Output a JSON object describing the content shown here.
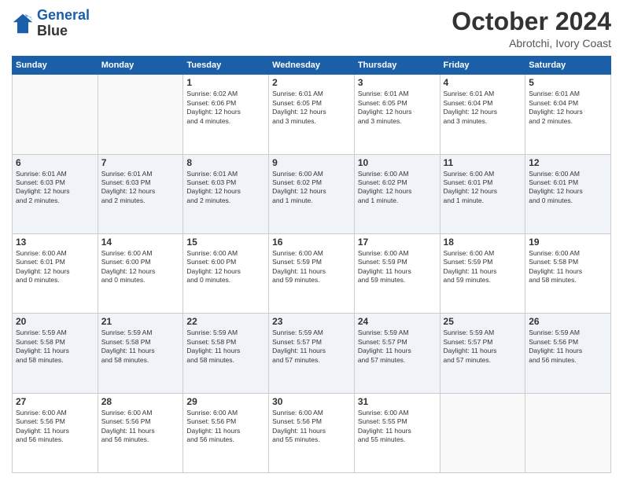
{
  "logo": {
    "line1": "General",
    "line2": "Blue"
  },
  "title": "October 2024",
  "location": "Abrotchi, Ivory Coast",
  "days_header": [
    "Sunday",
    "Monday",
    "Tuesday",
    "Wednesday",
    "Thursday",
    "Friday",
    "Saturday"
  ],
  "weeks": [
    {
      "shaded": false,
      "days": [
        {
          "num": "",
          "text": ""
        },
        {
          "num": "",
          "text": ""
        },
        {
          "num": "1",
          "text": "Sunrise: 6:02 AM\nSunset: 6:06 PM\nDaylight: 12 hours\nand 4 minutes."
        },
        {
          "num": "2",
          "text": "Sunrise: 6:01 AM\nSunset: 6:05 PM\nDaylight: 12 hours\nand 3 minutes."
        },
        {
          "num": "3",
          "text": "Sunrise: 6:01 AM\nSunset: 6:05 PM\nDaylight: 12 hours\nand 3 minutes."
        },
        {
          "num": "4",
          "text": "Sunrise: 6:01 AM\nSunset: 6:04 PM\nDaylight: 12 hours\nand 3 minutes."
        },
        {
          "num": "5",
          "text": "Sunrise: 6:01 AM\nSunset: 6:04 PM\nDaylight: 12 hours\nand 2 minutes."
        }
      ]
    },
    {
      "shaded": true,
      "days": [
        {
          "num": "6",
          "text": "Sunrise: 6:01 AM\nSunset: 6:03 PM\nDaylight: 12 hours\nand 2 minutes."
        },
        {
          "num": "7",
          "text": "Sunrise: 6:01 AM\nSunset: 6:03 PM\nDaylight: 12 hours\nand 2 minutes."
        },
        {
          "num": "8",
          "text": "Sunrise: 6:01 AM\nSunset: 6:03 PM\nDaylight: 12 hours\nand 2 minutes."
        },
        {
          "num": "9",
          "text": "Sunrise: 6:00 AM\nSunset: 6:02 PM\nDaylight: 12 hours\nand 1 minute."
        },
        {
          "num": "10",
          "text": "Sunrise: 6:00 AM\nSunset: 6:02 PM\nDaylight: 12 hours\nand 1 minute."
        },
        {
          "num": "11",
          "text": "Sunrise: 6:00 AM\nSunset: 6:01 PM\nDaylight: 12 hours\nand 1 minute."
        },
        {
          "num": "12",
          "text": "Sunrise: 6:00 AM\nSunset: 6:01 PM\nDaylight: 12 hours\nand 0 minutes."
        }
      ]
    },
    {
      "shaded": false,
      "days": [
        {
          "num": "13",
          "text": "Sunrise: 6:00 AM\nSunset: 6:01 PM\nDaylight: 12 hours\nand 0 minutes."
        },
        {
          "num": "14",
          "text": "Sunrise: 6:00 AM\nSunset: 6:00 PM\nDaylight: 12 hours\nand 0 minutes."
        },
        {
          "num": "15",
          "text": "Sunrise: 6:00 AM\nSunset: 6:00 PM\nDaylight: 12 hours\nand 0 minutes."
        },
        {
          "num": "16",
          "text": "Sunrise: 6:00 AM\nSunset: 5:59 PM\nDaylight: 11 hours\nand 59 minutes."
        },
        {
          "num": "17",
          "text": "Sunrise: 6:00 AM\nSunset: 5:59 PM\nDaylight: 11 hours\nand 59 minutes."
        },
        {
          "num": "18",
          "text": "Sunrise: 6:00 AM\nSunset: 5:59 PM\nDaylight: 11 hours\nand 59 minutes."
        },
        {
          "num": "19",
          "text": "Sunrise: 6:00 AM\nSunset: 5:58 PM\nDaylight: 11 hours\nand 58 minutes."
        }
      ]
    },
    {
      "shaded": true,
      "days": [
        {
          "num": "20",
          "text": "Sunrise: 5:59 AM\nSunset: 5:58 PM\nDaylight: 11 hours\nand 58 minutes."
        },
        {
          "num": "21",
          "text": "Sunrise: 5:59 AM\nSunset: 5:58 PM\nDaylight: 11 hours\nand 58 minutes."
        },
        {
          "num": "22",
          "text": "Sunrise: 5:59 AM\nSunset: 5:58 PM\nDaylight: 11 hours\nand 58 minutes."
        },
        {
          "num": "23",
          "text": "Sunrise: 5:59 AM\nSunset: 5:57 PM\nDaylight: 11 hours\nand 57 minutes."
        },
        {
          "num": "24",
          "text": "Sunrise: 5:59 AM\nSunset: 5:57 PM\nDaylight: 11 hours\nand 57 minutes."
        },
        {
          "num": "25",
          "text": "Sunrise: 5:59 AM\nSunset: 5:57 PM\nDaylight: 11 hours\nand 57 minutes."
        },
        {
          "num": "26",
          "text": "Sunrise: 5:59 AM\nSunset: 5:56 PM\nDaylight: 11 hours\nand 56 minutes."
        }
      ]
    },
    {
      "shaded": false,
      "days": [
        {
          "num": "27",
          "text": "Sunrise: 6:00 AM\nSunset: 5:56 PM\nDaylight: 11 hours\nand 56 minutes."
        },
        {
          "num": "28",
          "text": "Sunrise: 6:00 AM\nSunset: 5:56 PM\nDaylight: 11 hours\nand 56 minutes."
        },
        {
          "num": "29",
          "text": "Sunrise: 6:00 AM\nSunset: 5:56 PM\nDaylight: 11 hours\nand 56 minutes."
        },
        {
          "num": "30",
          "text": "Sunrise: 6:00 AM\nSunset: 5:56 PM\nDaylight: 11 hours\nand 55 minutes."
        },
        {
          "num": "31",
          "text": "Sunrise: 6:00 AM\nSunset: 5:55 PM\nDaylight: 11 hours\nand 55 minutes."
        },
        {
          "num": "",
          "text": ""
        },
        {
          "num": "",
          "text": ""
        }
      ]
    }
  ]
}
